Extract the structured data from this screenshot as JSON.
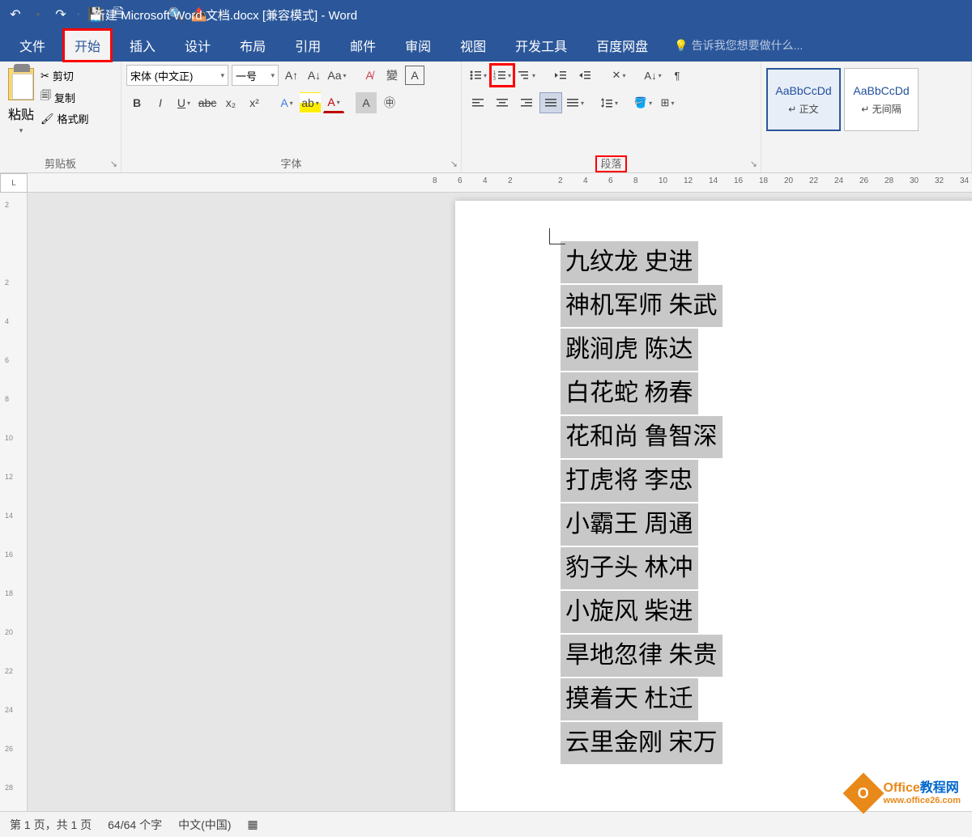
{
  "title": "新建 Microsoft Word 文档.docx [兼容模式] - Word",
  "tabs": {
    "file": "文件",
    "home": "开始",
    "insert": "插入",
    "design": "设计",
    "layout": "布局",
    "references": "引用",
    "mailings": "邮件",
    "review": "审阅",
    "view": "视图",
    "developer": "开发工具",
    "baidu": "百度网盘"
  },
  "tell_me": "告诉我您想要做什么...",
  "clipboard": {
    "label": "剪贴板",
    "paste": "粘贴",
    "cut": "剪切",
    "copy": "复制",
    "format_painter": "格式刷"
  },
  "font": {
    "label": "字体",
    "name": "宋体 (中文正)",
    "size": "一号"
  },
  "paragraph": {
    "label": "段落"
  },
  "styles": {
    "preview": "AaBbCcDd",
    "normal": "↵ 正文",
    "no_spacing": "↵ 无间隔"
  },
  "ruler_corner": "L",
  "hruler_ticks": [
    "8",
    "6",
    "4",
    "2",
    "",
    "2",
    "4",
    "6",
    "8",
    "10",
    "12",
    "14",
    "16",
    "18",
    "20",
    "22",
    "24",
    "26",
    "28",
    "30",
    "32",
    "34"
  ],
  "vruler_ticks": [
    "2",
    "",
    "2",
    "4",
    "6",
    "8",
    "10",
    "12",
    "14",
    "16",
    "18",
    "20",
    "22",
    "24",
    "26",
    "28"
  ],
  "document_lines": [
    "九纹龙  史进",
    "神机军师  朱武",
    "跳涧虎  陈达",
    "白花蛇  杨春",
    "花和尚  鲁智深",
    "打虎将  李忠",
    "小霸王  周通",
    "豹子头  林冲",
    "小旋风  柴进",
    "旱地忽律  朱贵",
    "摸着天  杜迁",
    "云里金刚  宋万"
  ],
  "statusbar": {
    "page": "第 1 页，共 1 页",
    "words": "64/64 个字",
    "lang": "中文(中国)"
  },
  "watermark": {
    "brand1": "Office",
    "brand2": "教程网",
    "url": "www.office26.com"
  }
}
